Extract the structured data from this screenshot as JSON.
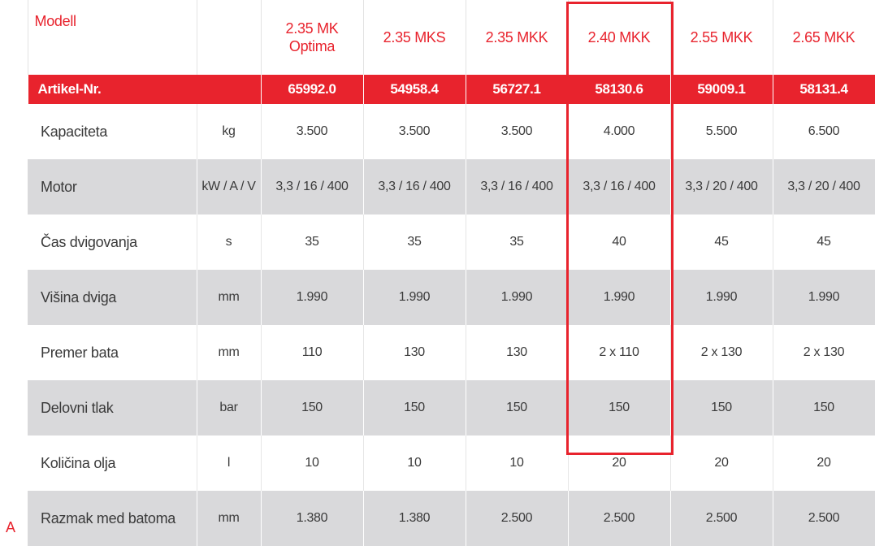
{
  "header": {
    "label": "Modell",
    "models": [
      "2.35 MK Optima",
      "2.35 MKS",
      "2.35 MKK",
      "2.40 MKK",
      "2.55 MKK",
      "2.65 MKK"
    ]
  },
  "article": {
    "label": "Artikel-Nr.",
    "values": [
      "65992.0",
      "54958.4",
      "56727.1",
      "58130.6",
      "59009.1",
      "58131.4"
    ]
  },
  "rows": [
    {
      "letter": "",
      "label": "Kapaciteta",
      "unit": "kg",
      "values": [
        "3.500",
        "3.500",
        "3.500",
        "4.000",
        "5.500",
        "6.500"
      ]
    },
    {
      "letter": "",
      "label": "Motor",
      "unit": "kW / A / V",
      "values": [
        "3,3 / 16 / 400",
        "3,3 / 16 / 400",
        "3,3 / 16 / 400",
        "3,3 / 16 / 400",
        "3,3 / 20 / 400",
        "3,3 / 20 / 400"
      ]
    },
    {
      "letter": "",
      "label": "Čas dvigovanja",
      "unit": "s",
      "values": [
        "35",
        "35",
        "35",
        "40",
        "45",
        "45"
      ]
    },
    {
      "letter": "",
      "label": "Višina dviga",
      "unit": "mm",
      "values": [
        "1.990",
        "1.990",
        "1.990",
        "1.990",
        "1.990",
        "1.990"
      ]
    },
    {
      "letter": "",
      "label": "Premer bata",
      "unit": "mm",
      "values": [
        "110",
        "130",
        "130",
        "2 x 110",
        "2 x 130",
        "2 x 130"
      ]
    },
    {
      "letter": "",
      "label": "Delovni tlak",
      "unit": "bar",
      "values": [
        "150",
        "150",
        "150",
        "150",
        "150",
        "150"
      ]
    },
    {
      "letter": "",
      "label": "Količina olja",
      "unit": "l",
      "values": [
        "10",
        "10",
        "10",
        "20",
        "20",
        "20"
      ]
    },
    {
      "letter": "A",
      "label": "Razmak med batoma",
      "unit": "mm",
      "values": [
        "1.380",
        "1.380",
        "2.500",
        "2.500",
        "2.500",
        "2.500"
      ]
    }
  ],
  "highlighted_model": "2.40 MKK",
  "colors": {
    "accent": "#e8232d",
    "stripe": "#d9d9db"
  }
}
